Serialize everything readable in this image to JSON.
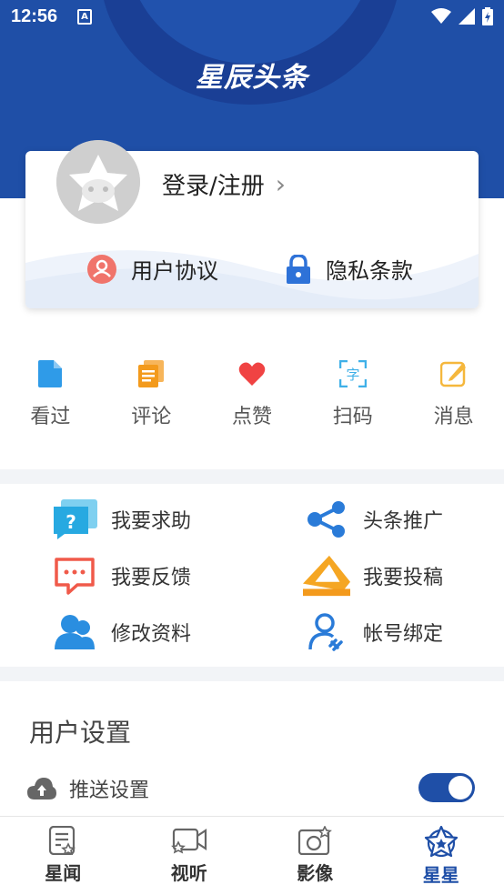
{
  "status": {
    "time": "12:56",
    "app_badge": "A"
  },
  "header": {
    "brand": "星辰头条"
  },
  "profile": {
    "login_label": "登录/注册",
    "user_agreement": "用户协议",
    "privacy_policy": "隐私条款"
  },
  "quick_actions": [
    {
      "label": "看过",
      "icon": "document-icon",
      "color": "#2f9be8"
    },
    {
      "label": "评论",
      "icon": "comment-doc-icon",
      "color": "#f39a1c"
    },
    {
      "label": "点赞",
      "icon": "heart-icon",
      "color": "#f04343"
    },
    {
      "label": "扫码",
      "icon": "scan-icon",
      "color": "#3fb0e8"
    },
    {
      "label": "消息",
      "icon": "edit-icon",
      "color": "#f5b73c"
    }
  ],
  "services": {
    "help": "我要求助",
    "promote": "头条推广",
    "feedback": "我要反馈",
    "submit": "我要投稿",
    "edit_profile": "修改资料",
    "bind_account": "帐号绑定"
  },
  "settings": {
    "title": "用户设置",
    "push_label": "推送设置",
    "push_enabled": true
  },
  "tabbar": {
    "tabs": [
      {
        "label": "星闻",
        "icon": "news-icon",
        "active": false
      },
      {
        "label": "视听",
        "icon": "video-icon",
        "active": false
      },
      {
        "label": "影像",
        "icon": "camera-icon",
        "active": false
      },
      {
        "label": "星星",
        "icon": "star-icon",
        "active": true
      }
    ]
  },
  "colors": {
    "brand_blue": "#1f4fa7",
    "divider": "#f2f4f7"
  }
}
